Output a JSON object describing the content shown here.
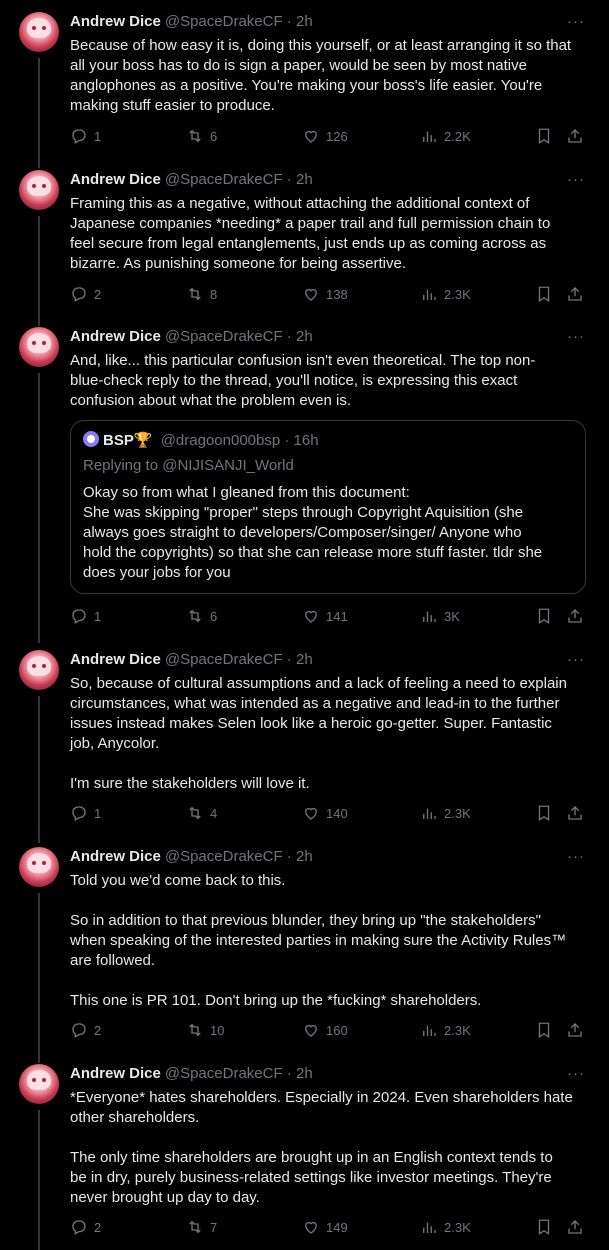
{
  "tweets": [
    {
      "name": "Andrew Dice",
      "handle": "@SpaceDrakeCF",
      "time": "2h",
      "more": "···",
      "text": "Because of how easy it is, doing this yourself, or at least arranging it so that\nall your boss has to do is sign a paper, would be seen by most native\nanglophones as a positive. You're making your boss's life easier. You're\nmaking stuff easier to produce.",
      "replies": "1",
      "retweets": "6",
      "likes": "126",
      "views": "2.2K"
    },
    {
      "name": "Andrew Dice",
      "handle": "@SpaceDrakeCF",
      "time": "2h",
      "more": "···",
      "text": "Framing this as a negative, without attaching the additional context of\nJapanese companies *needing* a paper trail and full permission chain to\nfeel secure from legal entanglements, just ends up as coming across as\nbizarre. As punishing someone for being assertive.",
      "replies": "2",
      "retweets": "8",
      "likes": "138",
      "views": "2.3K"
    },
    {
      "name": "Andrew Dice",
      "handle": "@SpaceDrakeCF",
      "time": "2h",
      "more": "···",
      "text": "And, like... this particular confusion isn't even theoretical. The top non-\nblue-check reply to the thread, you'll notice, is expressing this exact\nconfusion about what the problem even is.",
      "quote": {
        "name": "BSP🏆",
        "handle": "@dragoon000bsp",
        "time": "16h",
        "replying": "Replying to @NIJISANJI_World",
        "text": "Okay so from what I gleaned from this document:\nShe was skipping \"proper\" steps through Copyright Aquisition (she\nalways goes straight to developers/Composer/singer/ Anyone who\nhold the copyrights) so that she can release more stuff faster. tldr she\ndoes your jobs for you"
      },
      "replies": "1",
      "retweets": "6",
      "likes": "141",
      "views": "3K"
    },
    {
      "name": "Andrew Dice",
      "handle": "@SpaceDrakeCF",
      "time": "2h",
      "more": "···",
      "text": "So, because of cultural assumptions and a lack of feeling a need to explain\ncircumstances, what was intended as a negative and lead-in to the further\nissues instead makes Selen look like a heroic go-getter. Super. Fantastic\njob, Anycolor.\n\nI'm sure the stakeholders will love it.",
      "replies": "1",
      "retweets": "4",
      "likes": "140",
      "views": "2.3K"
    },
    {
      "name": "Andrew Dice",
      "handle": "@SpaceDrakeCF",
      "time": "2h",
      "more": "···",
      "text": "Told you we'd come back to this.\n\nSo in addition to that previous blunder, they bring up \"the stakeholders\"\nwhen speaking of the interested parties in making sure the Activity Rules™\nare followed.\n\nThis one is PR 101. Don't bring up the *fucking* shareholders.",
      "replies": "2",
      "retweets": "10",
      "likes": "160",
      "views": "2.3K"
    },
    {
      "name": "Andrew Dice",
      "handle": "@SpaceDrakeCF",
      "time": "2h",
      "more": "···",
      "text": "*Everyone* hates shareholders. Especially in 2024. Even shareholders hate\nother shareholders.\n\nThe only time shareholders are brought up in an English context tends to\nbe in dry, purely business-related settings like investor meetings. They're\nnever brought up day to day.",
      "replies": "2",
      "retweets": "7",
      "likes": "149",
      "views": "2.3K"
    }
  ]
}
